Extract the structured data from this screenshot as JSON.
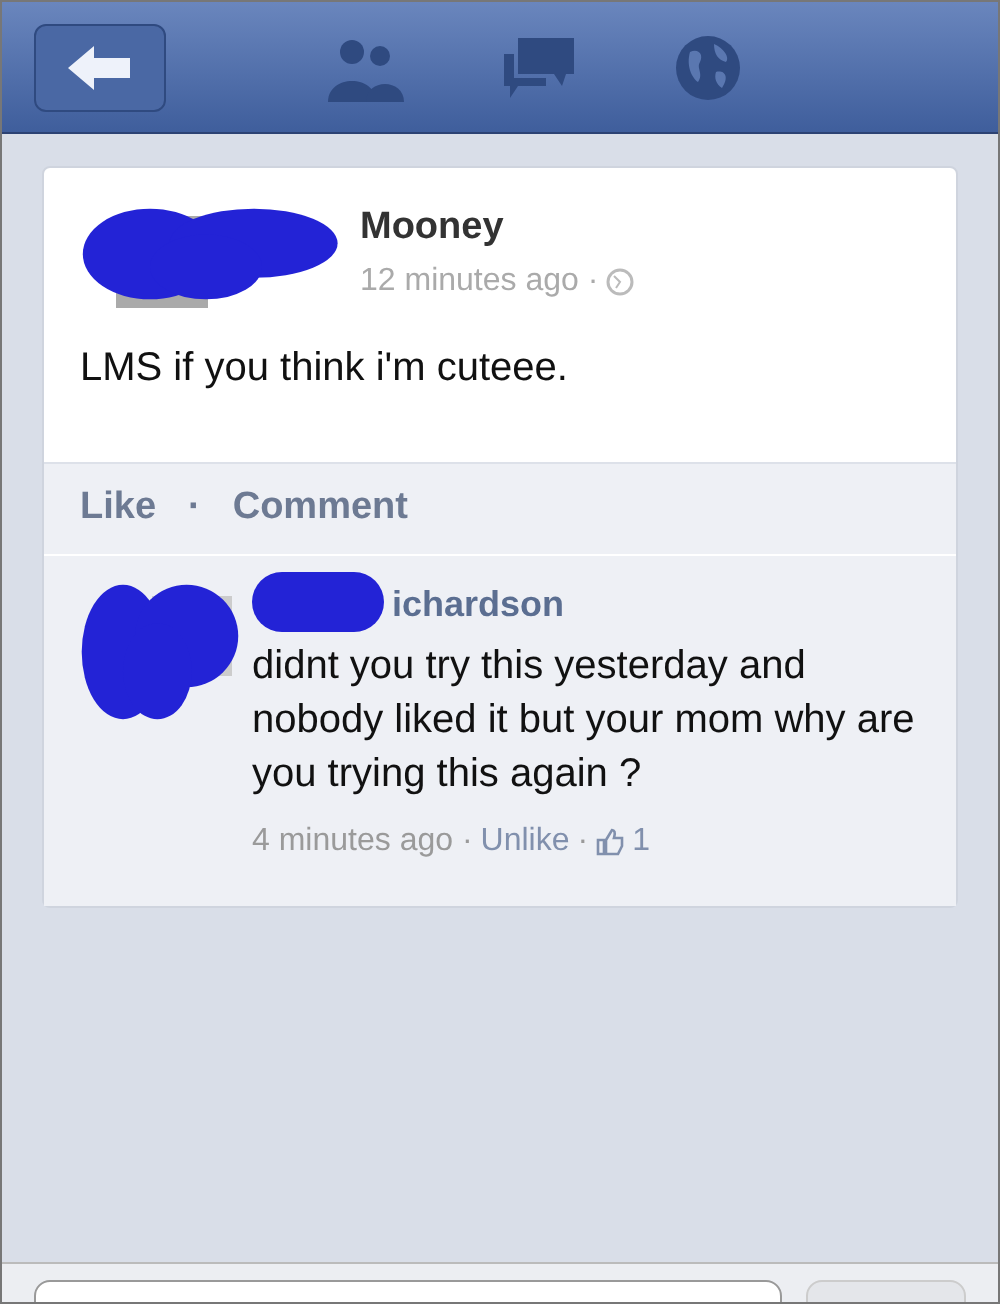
{
  "post": {
    "author": "Mooney",
    "time": "12 minutes ago ·",
    "text": "LMS if you think i'm cuteee.",
    "actions": [
      {
        "label": "Like"
      },
      {
        "label": "·"
      },
      {
        "label": "Comment"
      }
    ]
  },
  "comments": [
    {
      "author": "ichardson",
      "text": "didnt you try this yesterday and nobody liked it but your mom why are you trying this again ?",
      "time": "4 minutes ago ·",
      "action": "Unlike",
      "separator": "·",
      "likes": "1"
    }
  ]
}
